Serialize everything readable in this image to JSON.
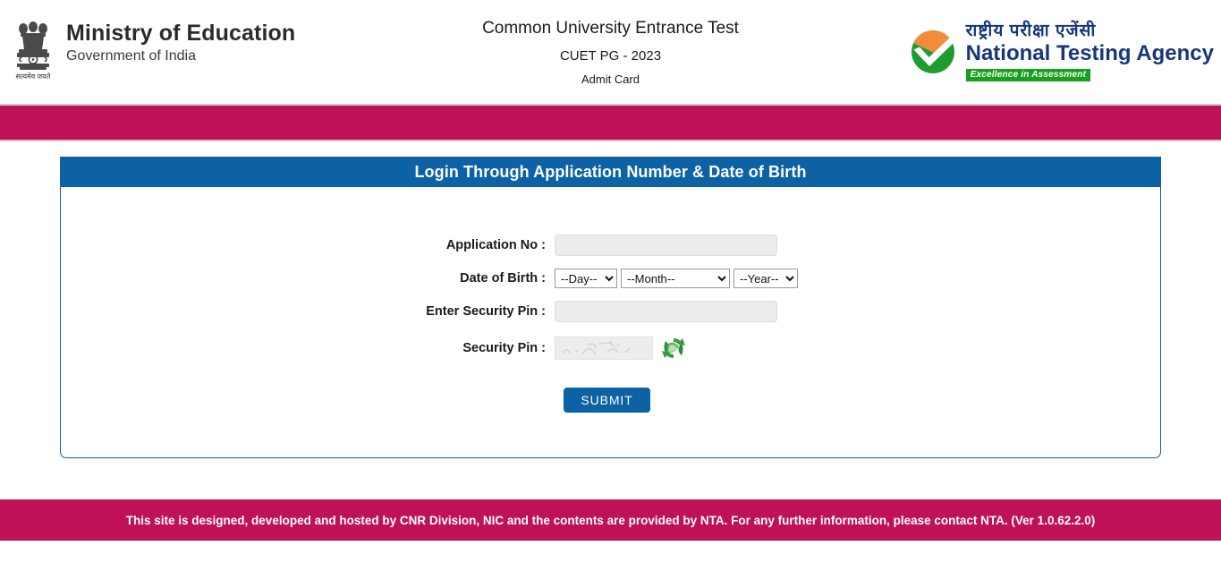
{
  "header": {
    "ministry_title": "Ministry of Education",
    "ministry_subtitle": "Government of India",
    "exam_title": "Common University Entrance Test",
    "exam_subtitle": "CUET PG - 2023",
    "document_type": "Admit Card",
    "agency_hindi": "राष्ट्रीय परीक्षा एजेंसी",
    "agency_english": "National Testing Agency",
    "agency_tagline": "Excellence in Assessment"
  },
  "panel": {
    "title": "Login Through Application Number & Date of Birth"
  },
  "form": {
    "application_no": {
      "label": "Application No :",
      "value": "",
      "placeholder": ""
    },
    "date_of_birth": {
      "label": "Date of Birth :",
      "day": {
        "selected": "--Day--",
        "options": [
          "--Day--"
        ]
      },
      "month": {
        "selected": "--Month--",
        "options": [
          "--Month--"
        ]
      },
      "year": {
        "selected": "--Year--",
        "options": [
          "--Year--"
        ]
      }
    },
    "enter_security_pin": {
      "label": "Enter Security Pin :",
      "value": "",
      "placeholder": ""
    },
    "security_pin": {
      "label": "Security Pin :",
      "captcha_alt": "captcha-image",
      "refresh_icon": "refresh-icon"
    },
    "submit_label": "SUBMIT"
  },
  "footer": {
    "text": "This site is designed, developed and hosted by CNR Division, NIC and the contents are provided by NTA. For any further information, please contact NTA. (Ver 1.0.62.2.0)"
  },
  "colors": {
    "magenta": "#bf1155",
    "blue": "#0d62a6",
    "nta_navy": "#15377a",
    "nta_orange": "#f08c3a",
    "nta_green": "#1e9c32",
    "tag_green": "#17a01c",
    "input_gray": "#ececec"
  }
}
